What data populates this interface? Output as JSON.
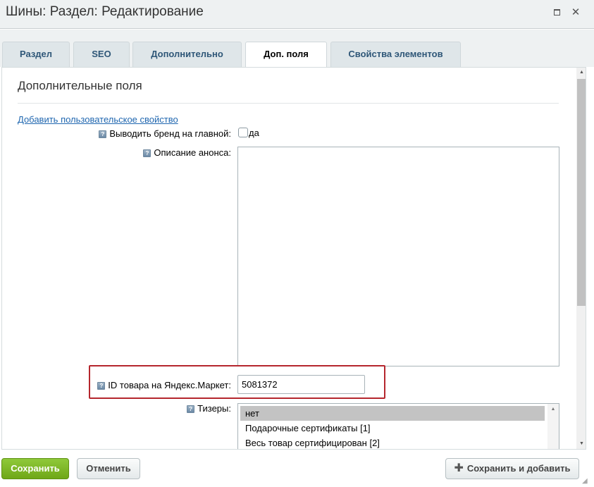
{
  "window": {
    "title": "Шины: Раздел: Редактирование"
  },
  "tabs": [
    {
      "label": "Раздел"
    },
    {
      "label": "SEO"
    },
    {
      "label": "Дополнительно"
    },
    {
      "label": "Доп. поля",
      "active": true
    },
    {
      "label": "Свойства элементов"
    }
  ],
  "section": {
    "title": "Дополнительные поля",
    "add_link": "Добавить пользовательское свойство"
  },
  "fields": {
    "brand_label": "Выводить бренд на главной:",
    "brand_checkbox_label": "да",
    "brand_checked": false,
    "announce_label": "Описание анонса:",
    "announce_value": "",
    "yandex_label": "ID товара на Яндекс.Маркет:",
    "yandex_value": "5081372",
    "teasers_label": "Тизеры:",
    "teasers_options": [
      {
        "label": "нет",
        "selected": true
      },
      {
        "label": "Подарочные сертификаты [1]"
      },
      {
        "label": "Весь товар сертифицирован [2]"
      }
    ]
  },
  "footer": {
    "save_label": "Сохранить",
    "cancel_label": "Отменить",
    "save_add_label": "Сохранить и добавить"
  },
  "icons": {
    "help": "help-icon",
    "add": "plus-icon",
    "maximize": "maximize-icon",
    "close": "close-icon"
  },
  "colors": {
    "save_button": "#7bb52a",
    "highlight": "#b5262d",
    "link": "#2067b0"
  }
}
